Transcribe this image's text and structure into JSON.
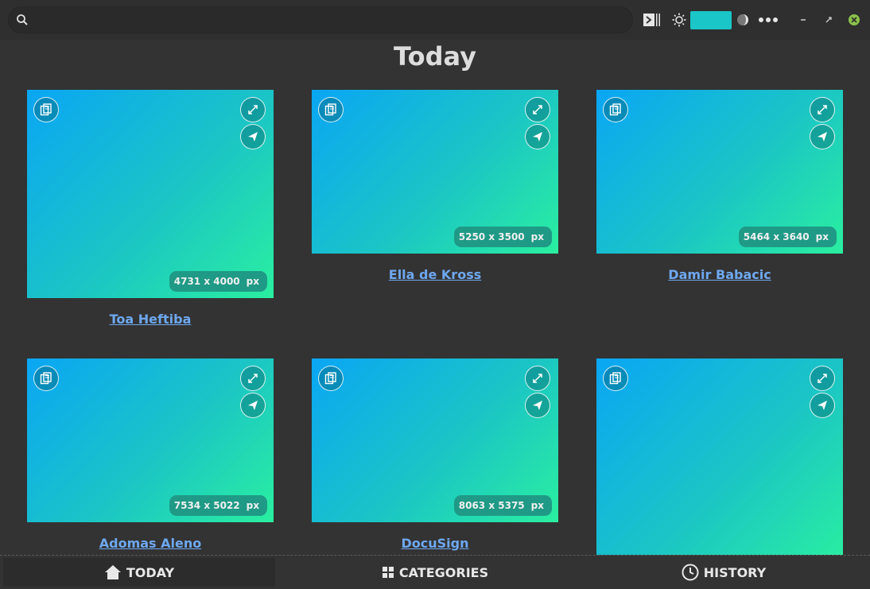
{
  "search": {
    "value": ""
  },
  "toolbar": {
    "color_swatch": "#1ac6c8",
    "accent_icon": "terminal-sidebar-icon",
    "brightness_icon": "sun-icon",
    "theme_icon": "half-moon-icon",
    "menu_icon": "more-dots-icon"
  },
  "page": {
    "title": "Today"
  },
  "cards": [
    {
      "author": "Toa Heftiba",
      "dimensions": "4731 x 4000",
      "unit": "px"
    },
    {
      "author": "Ella de Kross",
      "dimensions": "5250 x 3500",
      "unit": "px"
    },
    {
      "author": "Damir Babacic",
      "dimensions": "5464 x 3640",
      "unit": "px"
    },
    {
      "author": "Adomas Aleno",
      "dimensions": "7534 x 5022",
      "unit": "px"
    },
    {
      "author": "DocuSign",
      "dimensions": "8063 x 5375",
      "unit": "px"
    },
    {
      "author": "",
      "dimensions": "",
      "unit": ""
    }
  ],
  "nav": {
    "today": "TODAY",
    "categories": "CATEGORIES",
    "history": "HISTORY"
  },
  "colors": {
    "accent_link": "#6ea8f0",
    "gradient_start": "#0aa6f4",
    "gradient_end": "#2aefa0",
    "close_button": "#8bc34a"
  }
}
